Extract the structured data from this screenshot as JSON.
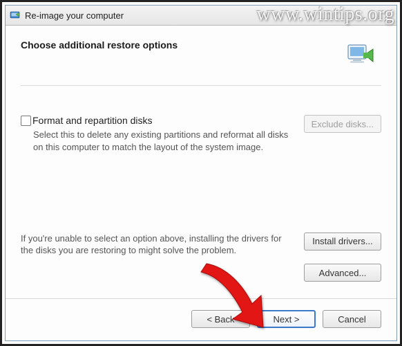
{
  "window": {
    "title": "Re-image your computer"
  },
  "header": {
    "heading": "Choose additional restore options"
  },
  "format": {
    "checkbox_label": "Format and repartition disks",
    "description": "Select this to delete any existing partitions and reformat all disks on this computer to match the layout of the system image.",
    "checked": false,
    "exclude_button": "Exclude disks..."
  },
  "drivers": {
    "info": "If you're unable to select an option above, installing the drivers for the disks you are restoring to might solve the problem.",
    "install_button": "Install drivers...",
    "advanced_button": "Advanced..."
  },
  "footer": {
    "back": "< Back",
    "next": "Next >",
    "cancel": "Cancel"
  },
  "watermark": "www.wintips.org"
}
